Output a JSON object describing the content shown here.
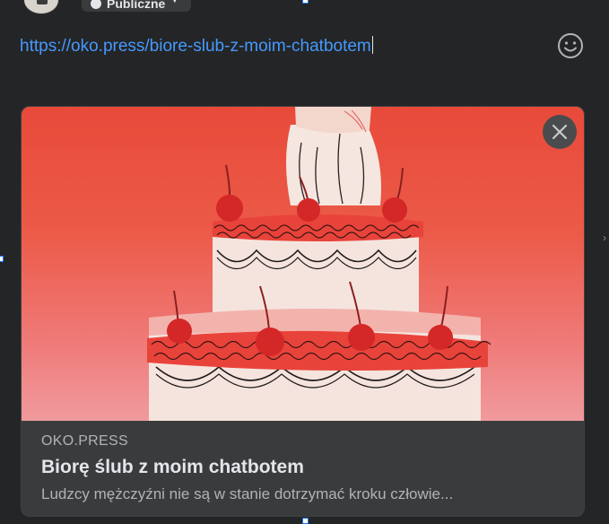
{
  "composer": {
    "audience_label": "Publiczne",
    "post_text": "https://oko.press/biore-slub-z-moim-chatbotem"
  },
  "link_preview": {
    "domain": "OKO.PRESS",
    "title": "Biorę ślub z moim chatbotem",
    "description": "Ludzcy mężczyźni nie są w stanie dotrzymać kroku człowie..."
  },
  "icons": {
    "emoji": "smiley-icon",
    "close": "close-icon",
    "audience": "globe-icon"
  },
  "colors": {
    "background": "#242526",
    "link_text": "#4599ff",
    "card_background": "#3a3b3c",
    "image_top": "#e84a3a",
    "image_bottom": "#f09a9e"
  }
}
